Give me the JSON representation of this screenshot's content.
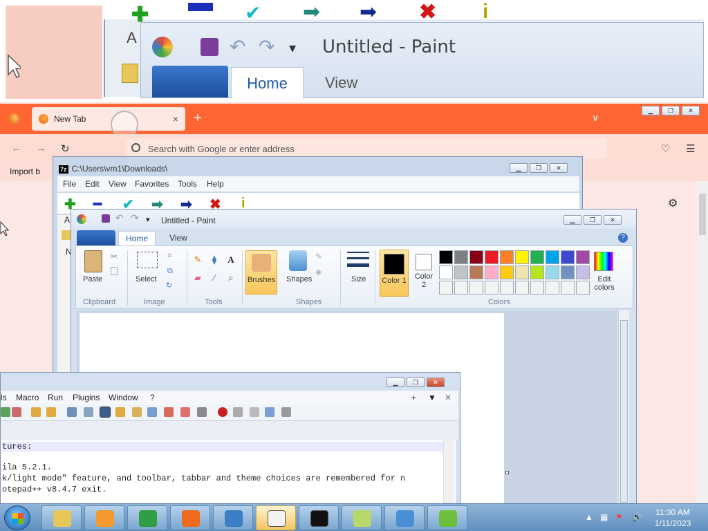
{
  "magnifier": {
    "paint_title": "Untitled - Paint",
    "home_tab": "Home",
    "view_tab": "View"
  },
  "firefox": {
    "tab_title": "New Tab",
    "tab_close": "×",
    "new_tab": "+",
    "url_placeholder": "Search with Google or enter address",
    "bookmark_import": "Import b",
    "back": "←",
    "forward": "→",
    "reload": "↻",
    "menu": "☰",
    "settings": "⚙",
    "list_tabs": "∨",
    "pocket": "♡"
  },
  "zip": {
    "title": "C:\\Users\\vm1\\Downloads\\",
    "logo": "7z",
    "menu": [
      "File",
      "Edit",
      "View",
      "Favorites",
      "Tools",
      "Help"
    ],
    "toolbar": [
      {
        "symbol": "✚",
        "color": "#1da31d",
        "icon": "add-icon"
      },
      {
        "symbol": "━",
        "color": "#1b2fb8",
        "icon": "extract-icon"
      },
      {
        "symbol": "✔",
        "color": "#14b8c4",
        "icon": "test-icon"
      },
      {
        "symbol": "➡",
        "color": "#1f8a7a",
        "icon": "copy-icon"
      },
      {
        "symbol": "➡",
        "color": "#142a8f",
        "icon": "move-icon"
      },
      {
        "symbol": "✖",
        "color": "#d01818",
        "icon": "delete-icon"
      },
      {
        "symbol": "i",
        "color": "#b9a400",
        "icon": "info-icon"
      }
    ],
    "partial_label": "A",
    "list_header": "Na"
  },
  "paint": {
    "title": "Untitled - Paint",
    "tabs": {
      "home": "Home",
      "view": "View"
    },
    "help": "?",
    "groups": {
      "clipboard": "Clipboard",
      "image": "Image",
      "tools": "Tools",
      "shapes": "Shapes",
      "colors": "Colors"
    },
    "buttons": {
      "paste": "Paste",
      "select": "Select",
      "brushes": "Brushes",
      "shapes": "Shapes",
      "size": "Size",
      "color1": "Color 1",
      "color2": "Color 2",
      "edit_colors": "Edit colors"
    },
    "palette": [
      "#000000",
      "#7f7f7f",
      "#880015",
      "#ed1c24",
      "#ff7f27",
      "#fff200",
      "#22b14c",
      "#00a2e8",
      "#3f48cc",
      "#a349a4",
      "#ffffff",
      "#c3c3c3",
      "#b97a57",
      "#ffaec9",
      "#ffc90e",
      "#efe4b0",
      "#b5e61d",
      "#99d9ea",
      "#7092be",
      "#c8bfe7",
      "#f3f3f3",
      "#f3f3f3",
      "#f3f3f3",
      "#f3f3f3",
      "#f3f3f3",
      "#f3f3f3",
      "#f3f3f3",
      "#f3f3f3",
      "#f3f3f3",
      "#f3f3f3"
    ]
  },
  "npp": {
    "menu": [
      "ls",
      "Macro",
      "Run",
      "Plugins",
      "Window",
      "?"
    ],
    "menu_right": [
      "+",
      "▼",
      "✕"
    ],
    "lines": [
      "tures:",
      "",
      "ila 5.2.1.",
      "k/light mode\" feature, and toolbar, tabbar and theme choices are remembered for n",
      "otepad++ v8.4.7 exit."
    ]
  },
  "taskbar": {
    "time": "11:30 AM",
    "date": "1/11/2023",
    "items": [
      {
        "icon": "explorer-icon",
        "color": "#e8c75a"
      },
      {
        "icon": "media-player-icon",
        "color": "#f29a2e"
      },
      {
        "icon": "chrome-icon",
        "color": "#2f9e44"
      },
      {
        "icon": "firefox-icon",
        "color": "#f06a1c"
      },
      {
        "icon": "network-icon",
        "color": "#3d7fc4"
      },
      {
        "icon": "solitaire-icon",
        "color": "#f2f2f2"
      },
      {
        "icon": "7zip-icon",
        "color": "#111111"
      },
      {
        "icon": "sticky-notes-icon",
        "color": "#b9d86a"
      },
      {
        "icon": "paint-icon",
        "color": "#4a8fd6"
      },
      {
        "icon": "notepad-plus-plus-icon",
        "color": "#6cbf3b"
      }
    ]
  }
}
